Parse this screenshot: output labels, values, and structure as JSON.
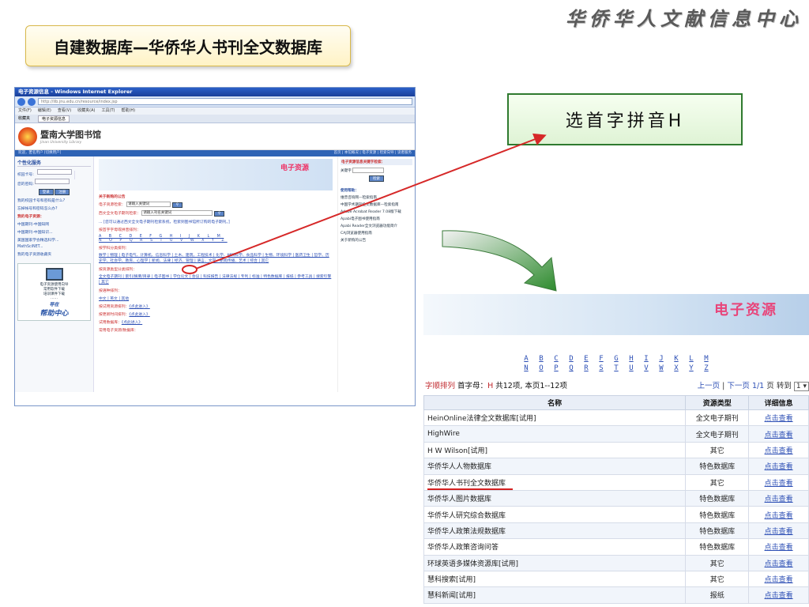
{
  "brand": "华侨华人文献信息中心",
  "slide_title": "自建数据库—华侨华人书刊全文数据库",
  "callout": "选首字拼音H",
  "browser": {
    "title": "电子资源信息 - Windows Internet Explorer",
    "url": "http://lib.jnu.edu.cn/resource/index.jsp",
    "menu": [
      "文件(F)",
      "编辑(E)",
      "查看(V)",
      "收藏夹(A)",
      "工具(T)",
      "帮助(H)"
    ],
    "tabs": [
      "收藏夹",
      "电子资源信息"
    ],
    "lib_name": "暨南大学图书馆",
    "lib_sub": "Jinan University Library",
    "strip_left": "欢迎，匿名用户 [切换用户]",
    "strip_right": "首页 | 本馆概况 | 电子资源 | 检索向导 | 读者服务",
    "left": {
      "section": "个性化服务",
      "card_label": "校园卡号:",
      "pwd_label": "您的密码:",
      "login": "登录",
      "reset": "注册",
      "q1": "我的校园卡号和密码是什么?",
      "q2": "忘掉帐号和密码怎么办?",
      "my_res": "我的电子资源：",
      "items": [
        "中国期刊-中国知网",
        "中国期刊-中国知识...",
        "美国国家学会精选科学...",
        "MathSciNET...",
        "我的电子资源收藏夹"
      ],
      "help_lines": [
        "电子资源使用向导",
        "常用软件下载",
        "培训课件下载",
        "……"
      ],
      "help_small": "导在",
      "help_big": "帮助中心"
    },
    "mid": {
      "banner": "电子资源",
      "notice": "关于新购的公告",
      "search1_label": "电子资源检索：",
      "search1_ph": "请输入关键词",
      "search2_label": "西文全文电子期刊检索：",
      "search2_ph": "请输入刊名关键词",
      "hint": "... [您可以通过西文全文电子期刊检索系统，检索到图书馆所订购的电子期刊。]",
      "by_letter": "按首字字母或拼音排列：",
      "letters_row1": "A B C D E F G H I J K L M",
      "letters_row2": "N O P Q R S T U V W X Y Z",
      "by_subject": "按学科分类排列：",
      "subjects": "数学 | 物理 | 电子电气、计算机、信息科学 | 土木、建筑、工程技术 | 化学、材料科学、食品科学 | 生物、环境科学 | 医药卫生 | 哲学、历史学、社会学、教育、心理学 | 新闻、法律 | 经济、管理 | 语言、文学、新闻传播、艺术 | 综合 | 其它",
      "by_type": "按资源类型分类排列：",
      "types": "全文电子期刊 | 索引/摘要/目录 | 电子图书 | 学位论文 | 会议 | 科技报告 | 法律法规 | 专利 | 标准 | 特色数据库 | 报纸 | 参考工具 | 搜索引擎 | 其它",
      "by_lang": "按语种排列：",
      "langs": "中文 | 英文 | 其他",
      "by_trial": "按试用资源排列：",
      "trial_link": "《点此进入》",
      "by_new": "按更新时间排列：",
      "new_link": "《点此进入》",
      "trial_db": "试用数据库：",
      "trial_db_link": "《点此进入》",
      "common": "常用电子资源/数据库："
    },
    "right": {
      "hd": "电子资源信息关键字检索：",
      "kw": "关键字",
      "btn": "检索",
      "help_hd": "使用帮助：",
      "items": [
        "维普咨询网—检索指南",
        "中国学术期刊全文数据库—检索指南",
        "Adobe Acrobat Reader 7.08版下载",
        "Apabi电子图书使用指南",
        "Apabi Reader全文浏览器功能简介",
        "CAJ浏览器使用指南",
        "关于新购的公告"
      ]
    }
  },
  "results": {
    "banner": "电子资源",
    "letters_row1": [
      "A",
      "B",
      "C",
      "D",
      "E",
      "F",
      "G",
      "H",
      "I",
      "J",
      "K",
      "L",
      "M"
    ],
    "letters_row2": [
      "N",
      "O",
      "P",
      "Q",
      "R",
      "S",
      "T",
      "U",
      "V",
      "W",
      "X",
      "Y",
      "Z"
    ],
    "sort_label": "字顺排列",
    "first_letter_label": "首字母：",
    "first_letter": "H",
    "total_label": "共12项, 本页1--12项",
    "prev": "上一页",
    "next": "下一页",
    "page_info": "1/1",
    "page_unit": "页",
    "goto": "转到",
    "page_select": "1",
    "columns": [
      "名称",
      "资源类型",
      "详细信息"
    ],
    "rows": [
      {
        "name": "HeinOnline法律全文数据库[试用]",
        "type": "全文电子期刊",
        "detail": "点击查看"
      },
      {
        "name": "HighWire",
        "type": "全文电子期刊",
        "detail": "点击查看"
      },
      {
        "name": "H W Wilson[试用]",
        "type": "其它",
        "detail": "点击查看"
      },
      {
        "name": "华侨华人人物数据库",
        "type": "特色数据库",
        "detail": "点击查看"
      },
      {
        "name": "华侨华人书刊全文数据库",
        "type": "其它",
        "detail": "点击查看"
      },
      {
        "name": "华侨华人图片数据库",
        "type": "特色数据库",
        "detail": "点击查看"
      },
      {
        "name": "华侨华人研究综合数据库",
        "type": "特色数据库",
        "detail": "点击查看"
      },
      {
        "name": "华侨华人政策法规数据库",
        "type": "特色数据库",
        "detail": "点击查看"
      },
      {
        "name": "华侨华人政策咨询问答",
        "type": "特色数据库",
        "detail": "点击查看"
      },
      {
        "name": "环球英语多媒体资源库[试用]",
        "type": "其它",
        "detail": "点击查看"
      },
      {
        "name": "慧科搜索[试用]",
        "type": "其它",
        "detail": "点击查看"
      },
      {
        "name": "慧科新闻[试用]",
        "type": "报纸",
        "detail": "点击查看"
      }
    ]
  }
}
